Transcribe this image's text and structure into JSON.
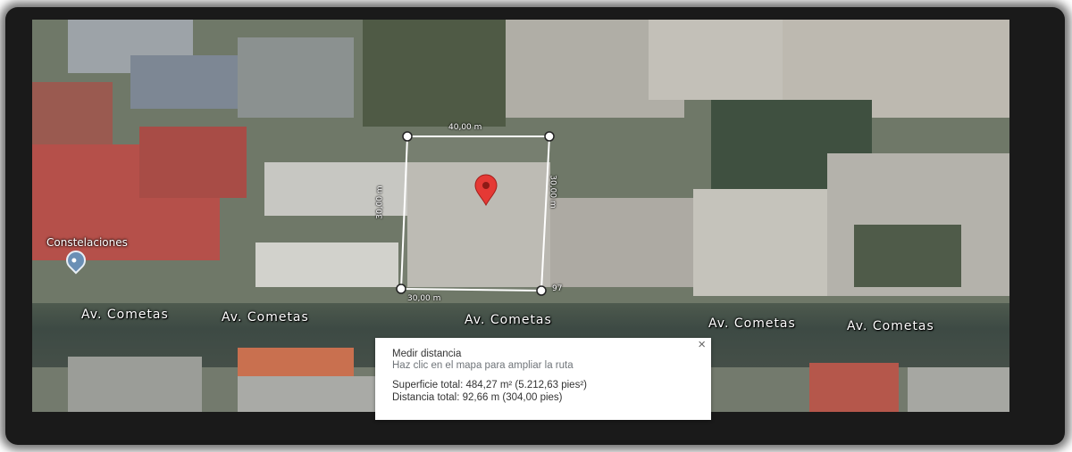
{
  "map": {
    "streets": [
      "Av. Cometas",
      "Av. Cometas",
      "Av. Cometas",
      "Av. Cometas",
      "Av. Cometas"
    ],
    "place": {
      "name": "Constelaciones",
      "icon": "place-pin-icon"
    },
    "marker": {
      "icon": "map-pin-icon",
      "color": "#e53935"
    },
    "measurement_labels": {
      "top": "40,00 m",
      "bottom": "30,00 m",
      "left": "30,00 m",
      "right": "30,00 m",
      "corner": "97"
    },
    "line_color": "#ffffff"
  },
  "panel": {
    "title": "Medir distancia",
    "subtitle": "Haz clic en el mapa para ampliar la ruta",
    "area": "Superficie total: 484,27 m² (5.212,63 pies²)",
    "distance": "Distancia total: 92,66 m (304,00 pies)",
    "close_icon": "close-icon"
  }
}
